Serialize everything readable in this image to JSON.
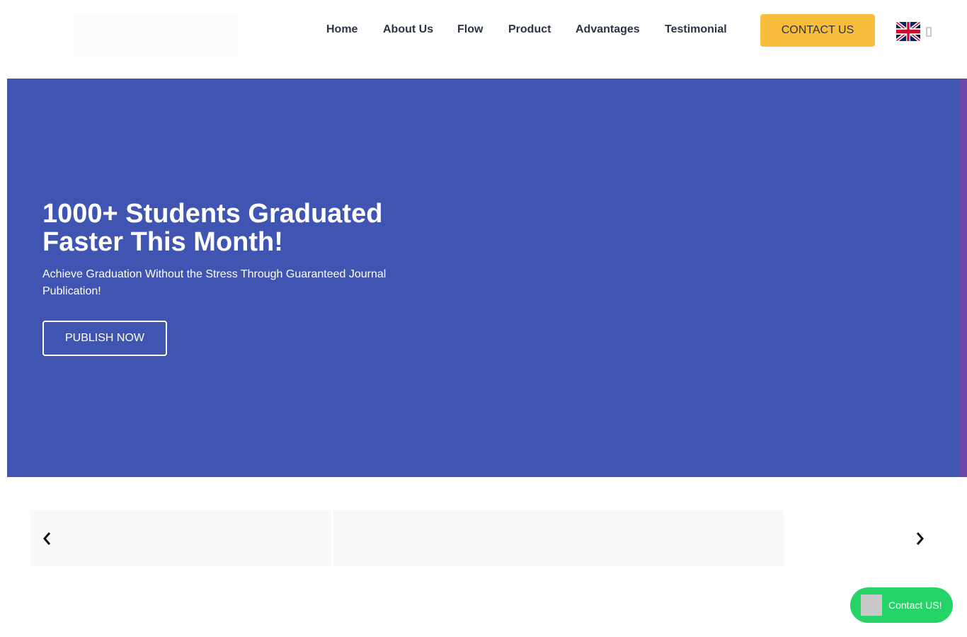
{
  "nav": {
    "items": [
      {
        "label": "Home"
      },
      {
        "label": "About Us"
      },
      {
        "label": "Flow"
      },
      {
        "label": "Product"
      },
      {
        "label": "Advantages"
      },
      {
        "label": "Testimonial"
      }
    ],
    "contact_label": "CONTACT US",
    "language_flag": "uk-flag-icon",
    "language_caret": "chevron-down-icon"
  },
  "hero": {
    "title": "1000+ Students Graduated Faster This Month!",
    "subtitle": "Achieve Graduation Without the Stress Through Guaranteed Journal Publication!",
    "cta_label": "PUBLISH NOW",
    "background_color": "#4055b1"
  },
  "carousel": {
    "prev_icon": "chevron-left-icon",
    "next_icon": "chevron-right-icon"
  },
  "float_contact": {
    "label": "Contact US!",
    "color": "#25d366"
  },
  "colors": {
    "accent": "#f8bd3a",
    "text": "#2b3445"
  }
}
